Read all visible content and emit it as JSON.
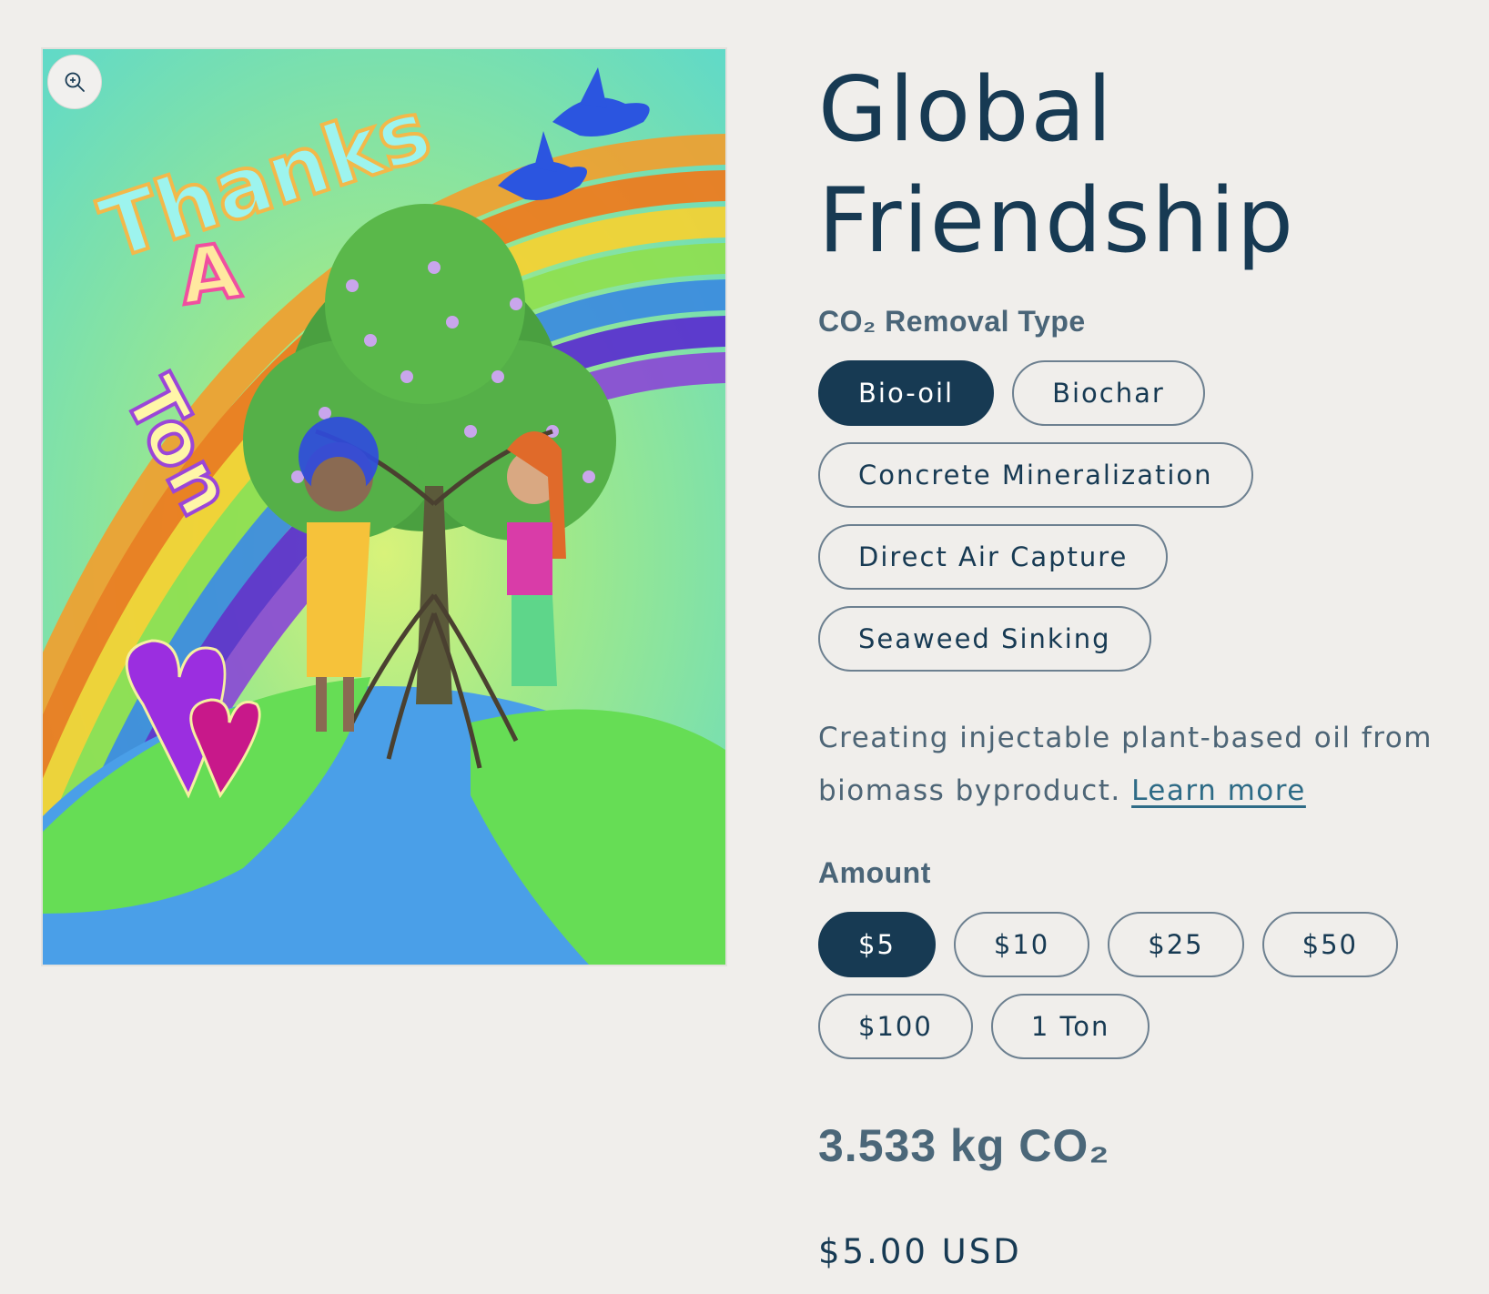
{
  "product": {
    "title_line1": "Global",
    "title_line2": "Friendship",
    "image_alt": "Thanks A Ton illustration"
  },
  "artwork": {
    "word1": "Thanks",
    "word2": "A",
    "word3": "Ton"
  },
  "removal_type": {
    "label": "CO₂ Removal Type",
    "options": [
      "Bio-oil",
      "Biochar",
      "Concrete Mineralization",
      "Direct Air Capture",
      "Seaweed Sinking"
    ],
    "selected": "Bio-oil"
  },
  "description": {
    "text": "Creating injectable plant-based oil from biomass byproduct. ",
    "link": "Learn more"
  },
  "amount": {
    "label": "Amount",
    "options": [
      "$5",
      "$10",
      "$25",
      "$50",
      "$100",
      "1 Ton"
    ],
    "selected": "$5"
  },
  "co2_result": "3.533 kg CO₂",
  "price": "$5.00 USD",
  "icons": {
    "zoom": "zoom-in-icon"
  },
  "colors": {
    "primary": "#173a53",
    "background": "#f0eeeb",
    "muted_text": "#4d6576"
  }
}
